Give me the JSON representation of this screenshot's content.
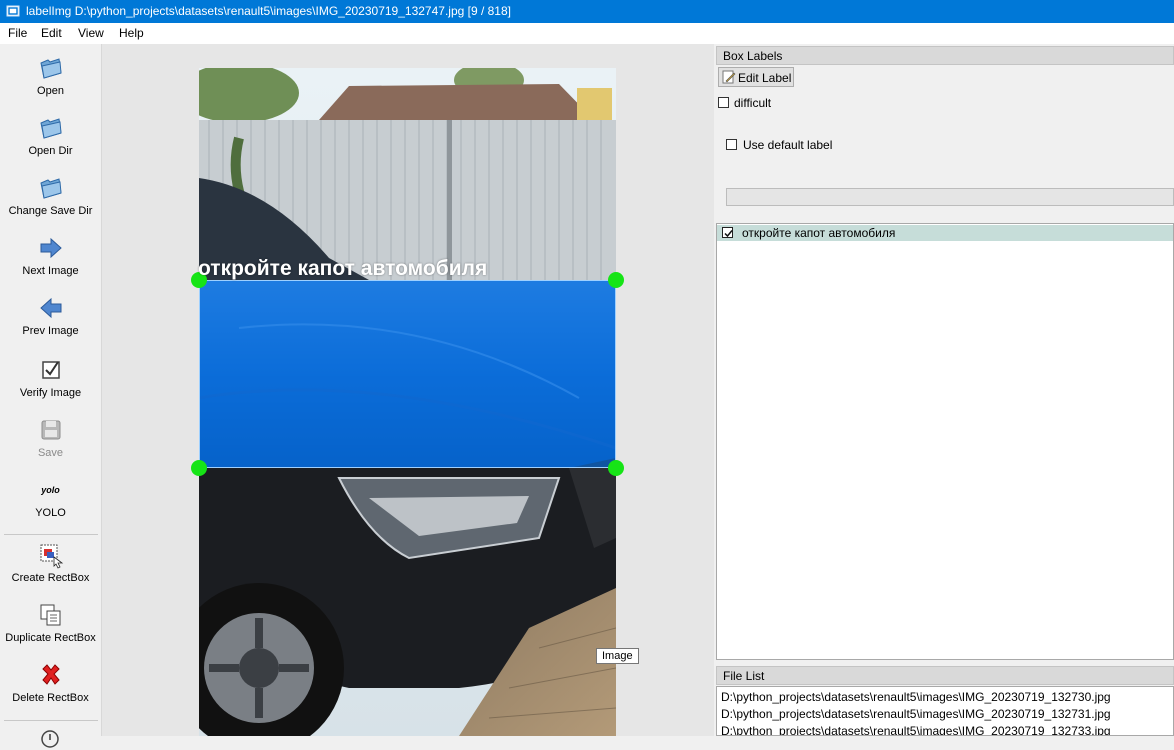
{
  "window": {
    "title": "labelImg D:\\python_projects\\datasets\\renault5\\images\\IMG_20230719_132747.jpg [9 / 818]"
  },
  "menu": [
    "File",
    "Edit",
    "View",
    "Help"
  ],
  "toolbar": {
    "open": "Open",
    "open_dir": "Open Dir",
    "change_save_dir": "Change Save Dir",
    "next_image": "Next Image",
    "prev_image": "Prev Image",
    "verify_image": "Verify Image",
    "save": "Save",
    "format_icon_text": "yolo",
    "format": "YOLO",
    "create_rectbox": "Create RectBox",
    "duplicate_rectbox": "Duplicate RectBox",
    "delete_rectbox": "Delete RectBox"
  },
  "canvas": {
    "box_label": "откройте капот автомобиля",
    "tooltip": "Image"
  },
  "box_labels": {
    "title": "Box Labels",
    "edit_label": "Edit Label",
    "difficult": "difficult",
    "use_default_label": "Use default label",
    "items": [
      {
        "label": "откройте капот автомобиля",
        "checked": true
      }
    ]
  },
  "file_list": {
    "title": "File List",
    "files": [
      "D:\\python_projects\\datasets\\renault5\\images\\IMG_20230719_132730.jpg",
      "D:\\python_projects\\datasets\\renault5\\images\\IMG_20230719_132731.jpg",
      "D:\\python_projects\\datasets\\renault5\\images\\IMG_20230719_132733.jpg"
    ]
  },
  "colors": {
    "titlebar": "#0078d7",
    "bbox_fill": "#006ee6",
    "handle": "#16e416",
    "selected_row": "#c6ddd9"
  }
}
